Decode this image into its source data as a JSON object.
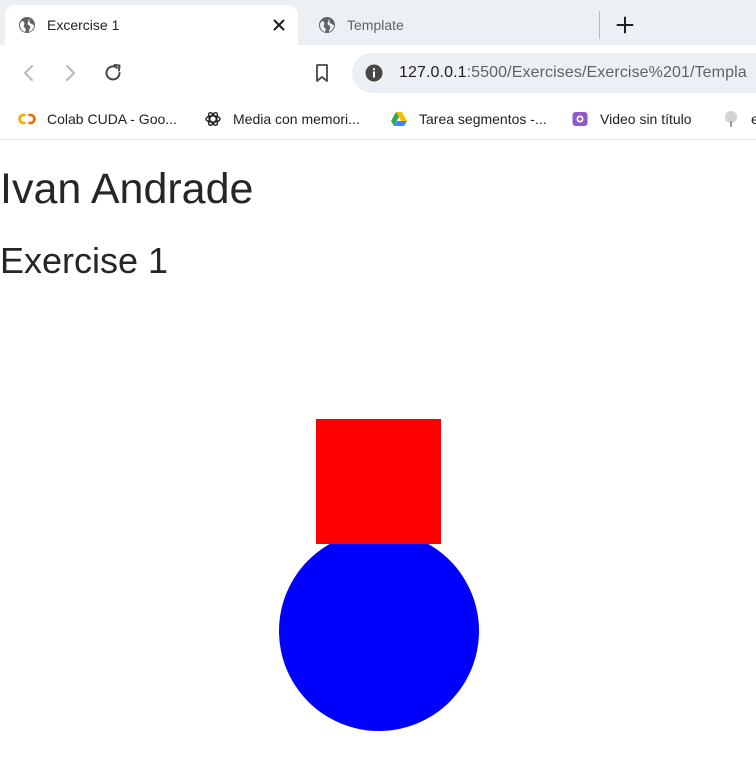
{
  "browser": {
    "tabs": [
      {
        "title": "Excercise 1",
        "active": true
      },
      {
        "title": "Template",
        "active": false
      }
    ],
    "url": {
      "host": "127.0.0.1",
      "path": ":5500/Exercises/Exercise%201/Templa"
    },
    "bookmarks": [
      {
        "label": "Colab CUDA - Goo...",
        "icon": "colab-icon"
      },
      {
        "label": "Media con memori...",
        "icon": "openai-icon"
      },
      {
        "label": "Tarea segmentos -...",
        "icon": "google-drive-icon"
      },
      {
        "label": "Video sin título",
        "icon": "video-icon"
      },
      {
        "label": "e",
        "icon": "tree-icon"
      }
    ]
  },
  "page": {
    "heading": "Ivan Andrade",
    "subheading": "Exercise 1",
    "shapes": {
      "square_color": "#ff0000",
      "circle_color": "#0000ff"
    }
  }
}
